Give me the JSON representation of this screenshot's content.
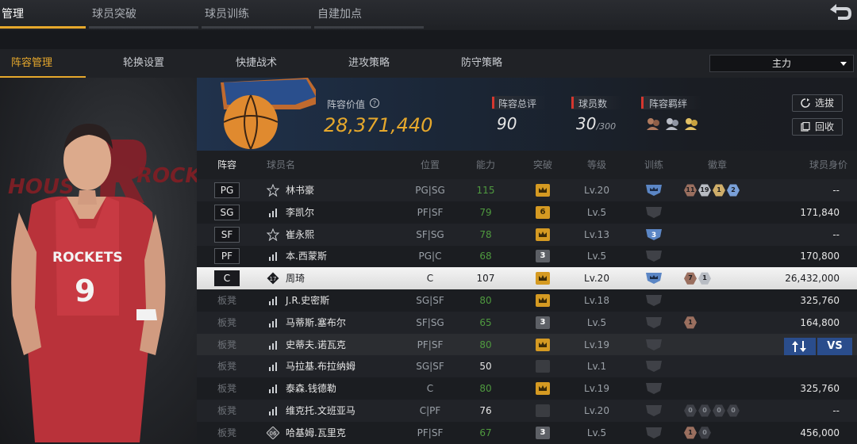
{
  "top_tabs": [
    {
      "label": "管理",
      "active": true
    },
    {
      "label": "球员突破",
      "active": false
    },
    {
      "label": "球员训练",
      "active": false
    },
    {
      "label": "自建加点",
      "active": false
    }
  ],
  "sub_tabs": [
    {
      "label": "阵容管理",
      "active": true
    },
    {
      "label": "轮换设置",
      "active": false
    },
    {
      "label": "快捷战术",
      "active": false
    },
    {
      "label": "进攻策略",
      "active": false
    },
    {
      "label": "防守策略",
      "active": false
    }
  ],
  "formation_select": {
    "value": "主力"
  },
  "portrait": {
    "team_text_left": "HOUS",
    "team_text_right": "ROCK",
    "jersey_team": "ROCKETS",
    "jersey_number": "9"
  },
  "summary": {
    "lineup_value_label": "阵容价值",
    "lineup_value": "28,371,440",
    "rating_label": "阵容总评",
    "rating": "90",
    "player_count_label": "球员数",
    "player_count": "30",
    "player_count_max": "/300",
    "bond_label": "阵容羁绊",
    "pick_button": "选拔",
    "recycle_button": "回收"
  },
  "columns": [
    "阵容",
    "球员名",
    "位置",
    "能力",
    "突破",
    "等级",
    "训练",
    "徽章",
    "球员身价"
  ],
  "players": [
    {
      "slot": "PG",
      "name": "林书豪",
      "pos": "PG|SG",
      "ability": "115",
      "breakthrough": "crown",
      "level": "Lv.20",
      "train": "crown-blue",
      "badges": [
        [
          "bronze",
          "11"
        ],
        [
          "silver",
          "19"
        ],
        [
          "gold",
          "1"
        ],
        [
          "blue",
          "2"
        ]
      ],
      "price": "--"
    },
    {
      "slot": "SG",
      "name": "李凯尔",
      "pos": "PF|SF",
      "ability": "79",
      "breakthrough": "6",
      "level": "Lv.5",
      "train": "empty",
      "badges": [],
      "price": "171,840"
    },
    {
      "slot": "SF",
      "name": "崔永熙",
      "pos": "SF|SG",
      "ability": "78",
      "breakthrough": "crown",
      "level": "Lv.13",
      "train": "3",
      "badges": [],
      "price": "--"
    },
    {
      "slot": "PF",
      "name": "本.西蒙斯",
      "pos": "PG|C",
      "ability": "68",
      "breakthrough": "3",
      "level": "Lv.5",
      "train": "empty",
      "badges": [],
      "price": "170,800"
    },
    {
      "slot": "C",
      "name": "周琦",
      "pos": "C",
      "ability": "107",
      "rank": "17",
      "breakthrough": "crown",
      "level": "Lv.20",
      "train": "crown-blue",
      "badges": [
        [
          "bronze",
          "7"
        ],
        [
          "silver",
          "1"
        ]
      ],
      "price": "26,432,000"
    },
    {
      "slot": "板凳",
      "name": "J.R.史密斯",
      "pos": "SG|SF",
      "ability": "80",
      "breakthrough": "crown",
      "level": "Lv.18",
      "train": "empty",
      "badges": [],
      "price": "325,760"
    },
    {
      "slot": "板凳",
      "name": "马蒂斯.塞布尔",
      "pos": "SF|SG",
      "ability": "65",
      "breakthrough": "3",
      "level": "Lv.5",
      "train": "empty",
      "badges": [
        [
          "bronze",
          "1"
        ]
      ],
      "price": "164,800"
    },
    {
      "slot": "板凳",
      "name": "史蒂夫.诺瓦克",
      "pos": "PF|SF",
      "ability": "80",
      "breakthrough": "crown",
      "level": "Lv.19",
      "train": "empty",
      "badges": [],
      "price": ""
    },
    {
      "slot": "板凳",
      "name": "马拉基.布拉纳姆",
      "pos": "SG|SF",
      "ability": "50",
      "breakthrough": "empty",
      "level": "Lv.1",
      "train": "empty",
      "badges": [],
      "price": ""
    },
    {
      "slot": "板凳",
      "name": "泰森.钱德勒",
      "pos": "C",
      "ability": "80",
      "breakthrough": "crown",
      "level": "Lv.19",
      "train": "empty",
      "badges": [],
      "price": "325,760"
    },
    {
      "slot": "板凳",
      "name": "维克托.文班亚马",
      "pos": "C|PF",
      "ability": "76",
      "breakthrough": "empty",
      "level": "Lv.20",
      "train": "empty",
      "badges": [
        [
          "dark",
          "0"
        ],
        [
          "dark",
          "0"
        ],
        [
          "dark",
          "0"
        ],
        [
          "dark",
          "0"
        ]
      ],
      "price": "--"
    },
    {
      "slot": "板凳",
      "name": "哈基姆.瓦里克",
      "pos": "PF|SF",
      "ability": "67",
      "rank": "06",
      "breakthrough": "3",
      "level": "Lv.5",
      "train": "empty",
      "badges": [
        [
          "bronze",
          "1"
        ],
        [
          "dark",
          "0"
        ]
      ],
      "price": "456,000"
    }
  ],
  "vs_button": "VS"
}
